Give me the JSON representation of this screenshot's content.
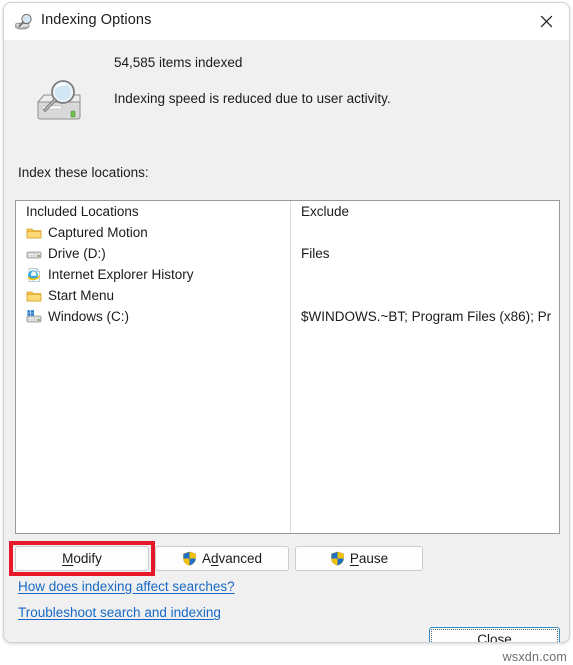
{
  "window": {
    "title": "Indexing Options",
    "title_icon": "indexing-drive-search-icon",
    "close_icon": "close-icon"
  },
  "header": {
    "status_icon": "hard-drive-magnifier-icon",
    "items_indexed": "54,585 items indexed",
    "speed_note": "Indexing speed is reduced due to user activity."
  },
  "locations": {
    "label": "Index these locations:",
    "columns": {
      "included": "Included Locations",
      "exclude": "Exclude"
    },
    "rows": [
      {
        "icon": "folder-icon",
        "name": "Captured Motion",
        "exclude": ""
      },
      {
        "icon": "drive-icon",
        "name": "Drive (D:)",
        "exclude": "Files"
      },
      {
        "icon": "internet-explorer-icon",
        "name": "Internet Explorer History",
        "exclude": ""
      },
      {
        "icon": "folder-icon",
        "name": "Start Menu",
        "exclude": ""
      },
      {
        "icon": "windows-drive-icon",
        "name": "Windows (C:)",
        "exclude": "$WINDOWS.~BT; Program Files (x86); Pr..."
      }
    ]
  },
  "buttons": {
    "modify": {
      "label": "Modify",
      "accel": "M",
      "shield": false
    },
    "advanced": {
      "label": "Advanced",
      "accel": "d",
      "shield": true
    },
    "pause": {
      "label": "Pause",
      "accel": "P",
      "shield": true
    },
    "close": {
      "label": "Close"
    }
  },
  "links": {
    "how": "How does indexing affect searches?",
    "troubleshoot": "Troubleshoot search and indexing"
  },
  "annotation": {
    "target": "modify-button",
    "color": "#e8182a"
  },
  "watermark": "wsxdn.com"
}
